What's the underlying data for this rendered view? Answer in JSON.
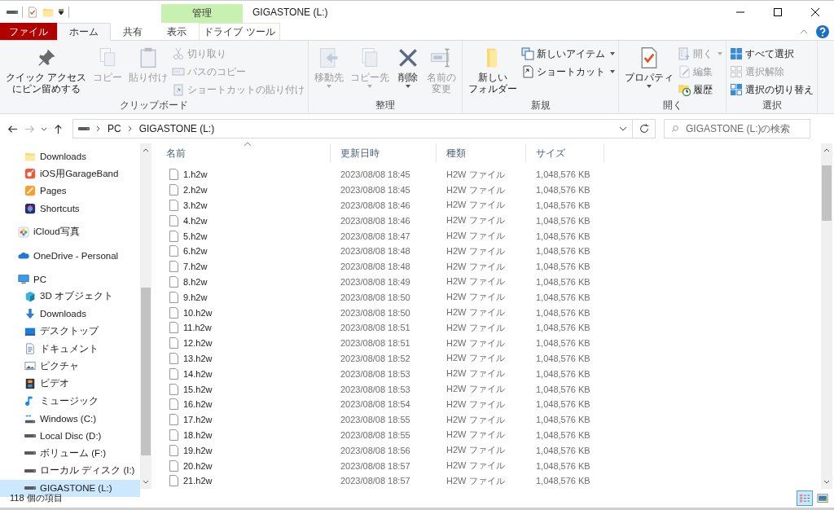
{
  "window": {
    "title": "GIGASTONE (L:)",
    "context_group": "管理"
  },
  "ribbon_tabs": [
    {
      "label": "ファイル",
      "kind": "file",
      "selected": false
    },
    {
      "label": "ホーム",
      "kind": "normal",
      "selected": true
    },
    {
      "label": "共有",
      "kind": "normal",
      "selected": false
    },
    {
      "label": "表示",
      "kind": "normal",
      "selected": false
    },
    {
      "label": "ドライブ ツール",
      "kind": "context",
      "selected": false
    }
  ],
  "ribbon_groups": [
    {
      "label": "クリップボード",
      "items": [
        {
          "lines": [
            "クイック アクセス",
            "にピン留めする"
          ],
          "kind": "large",
          "disabled": false,
          "has_menu": false
        },
        {
          "label": "コピー",
          "kind": "large",
          "disabled": true,
          "has_menu": false
        },
        {
          "label": "貼り付け",
          "kind": "large",
          "disabled": true,
          "has_menu": false
        },
        {
          "label": "切り取り",
          "kind": "small",
          "disabled": true,
          "has_menu": false
        },
        {
          "label": "パスのコピー",
          "kind": "small",
          "disabled": true,
          "has_menu": false
        },
        {
          "label": "ショートカットの貼り付け",
          "kind": "small",
          "disabled": true,
          "has_menu": false
        }
      ]
    },
    {
      "label": "整理",
      "items": [
        {
          "label": "移動先",
          "kind": "large",
          "disabled": true,
          "has_menu": true
        },
        {
          "label": "コピー先",
          "kind": "large",
          "disabled": true,
          "has_menu": true
        },
        {
          "label": "削除",
          "kind": "large",
          "disabled": false,
          "has_menu": true
        },
        {
          "lines": [
            "名前の",
            "変更"
          ],
          "kind": "large",
          "disabled": true,
          "has_menu": false
        }
      ]
    },
    {
      "label": "新規",
      "items": [
        {
          "lines": [
            "新しい",
            "フォルダー"
          ],
          "kind": "large",
          "disabled": false,
          "has_menu": false
        },
        {
          "label": "新しいアイテム",
          "kind": "small",
          "disabled": false,
          "has_menu": true
        },
        {
          "label": "ショートカット",
          "kind": "small",
          "disabled": false,
          "has_menu": true
        }
      ]
    },
    {
      "label": "開く",
      "items": [
        {
          "label": "プロパティ",
          "kind": "large",
          "disabled": false,
          "has_menu": true
        },
        {
          "label": "開く",
          "kind": "small",
          "disabled": true,
          "has_menu": true
        },
        {
          "label": "編集",
          "kind": "small",
          "disabled": true,
          "has_menu": false
        },
        {
          "label": "履歴",
          "kind": "small",
          "disabled": false,
          "has_menu": false
        }
      ]
    },
    {
      "label": "選択",
      "items": [
        {
          "label": "すべて選択",
          "kind": "small",
          "disabled": false,
          "has_menu": false
        },
        {
          "label": "選択解除",
          "kind": "small",
          "disabled": true,
          "has_menu": false
        },
        {
          "label": "選択の切り替え",
          "kind": "small",
          "disabled": false,
          "has_menu": false
        }
      ]
    }
  ],
  "address_bar": {
    "path": [
      "PC",
      "GIGASTONE (L:)"
    ]
  },
  "search": {
    "placeholder": "GIGASTONE (L:)の検索"
  },
  "sidebar": {
    "quick_access_children": [
      {
        "label": "Downloads",
        "kind": "folder",
        "selected": false
      },
      {
        "label": "iOS用GarageBand",
        "kind": "guitar-app",
        "selected": false
      },
      {
        "label": "Pages",
        "kind": "pen-app",
        "selected": false
      },
      {
        "label": "Shortcuts",
        "kind": "layers-app",
        "selected": false
      }
    ],
    "items": [
      {
        "label": "iCloud写真",
        "kind": "photos",
        "selected": false
      },
      {
        "label": "OneDrive - Personal",
        "kind": "cloud",
        "selected": false
      },
      {
        "label": "PC",
        "kind": "pc",
        "selected": false,
        "children": [
          {
            "label": "3D オブジェクト",
            "kind": "cube",
            "selected": false
          },
          {
            "label": "Downloads",
            "kind": "download",
            "selected": false
          },
          {
            "label": "デスクトップ",
            "kind": "desktop",
            "selected": false
          },
          {
            "label": "ドキュメント",
            "kind": "document",
            "selected": false
          },
          {
            "label": "ピクチャ",
            "kind": "picture",
            "selected": false
          },
          {
            "label": "ビデオ",
            "kind": "video",
            "selected": false
          },
          {
            "label": "ミュージック",
            "kind": "music",
            "selected": false
          },
          {
            "label": "Windows (C:)",
            "kind": "windows-drive",
            "selected": false
          },
          {
            "label": "Local Disc (D:)",
            "kind": "drive",
            "selected": false
          },
          {
            "label": "ボリューム (F:)",
            "kind": "drive",
            "selected": false
          },
          {
            "label": "ローカル ディスク (I:)",
            "kind": "drive",
            "selected": false
          },
          {
            "label": "GIGASTONE (L:)",
            "kind": "drive",
            "selected": true
          }
        ]
      }
    ]
  },
  "table": {
    "columns": [
      {
        "label": "名前",
        "sorted": true
      },
      {
        "label": "更新日時",
        "sorted": false
      },
      {
        "label": "種類",
        "sorted": false
      },
      {
        "label": "サイズ",
        "sorted": false
      }
    ],
    "rows": [
      {
        "name": "1.h2w",
        "modified": "2023/08/08 18:45",
        "type": "H2W ファイル",
        "size": "1,048,576 KB"
      },
      {
        "name": "2.h2w",
        "modified": "2023/08/08 18:45",
        "type": "H2W ファイル",
        "size": "1,048,576 KB"
      },
      {
        "name": "3.h2w",
        "modified": "2023/08/08 18:46",
        "type": "H2W ファイル",
        "size": "1,048,576 KB"
      },
      {
        "name": "4.h2w",
        "modified": "2023/08/08 18:46",
        "type": "H2W ファイル",
        "size": "1,048,576 KB"
      },
      {
        "name": "5.h2w",
        "modified": "2023/08/08 18:47",
        "type": "H2W ファイル",
        "size": "1,048,576 KB"
      },
      {
        "name": "6.h2w",
        "modified": "2023/08/08 18:48",
        "type": "H2W ファイル",
        "size": "1,048,576 KB"
      },
      {
        "name": "7.h2w",
        "modified": "2023/08/08 18:48",
        "type": "H2W ファイル",
        "size": "1,048,576 KB"
      },
      {
        "name": "8.h2w",
        "modified": "2023/08/08 18:49",
        "type": "H2W ファイル",
        "size": "1,048,576 KB"
      },
      {
        "name": "9.h2w",
        "modified": "2023/08/08 18:50",
        "type": "H2W ファイル",
        "size": "1,048,576 KB"
      },
      {
        "name": "10.h2w",
        "modified": "2023/08/08 18:50",
        "type": "H2W ファイル",
        "size": "1,048,576 KB"
      },
      {
        "name": "11.h2w",
        "modified": "2023/08/08 18:51",
        "type": "H2W ファイル",
        "size": "1,048,576 KB"
      },
      {
        "name": "12.h2w",
        "modified": "2023/08/08 18:51",
        "type": "H2W ファイル",
        "size": "1,048,576 KB"
      },
      {
        "name": "13.h2w",
        "modified": "2023/08/08 18:52",
        "type": "H2W ファイル",
        "size": "1,048,576 KB"
      },
      {
        "name": "14.h2w",
        "modified": "2023/08/08 18:53",
        "type": "H2W ファイル",
        "size": "1,048,576 KB"
      },
      {
        "name": "15.h2w",
        "modified": "2023/08/08 18:53",
        "type": "H2W ファイル",
        "size": "1,048,576 KB"
      },
      {
        "name": "16.h2w",
        "modified": "2023/08/08 18:54",
        "type": "H2W ファイル",
        "size": "1,048,576 KB"
      },
      {
        "name": "17.h2w",
        "modified": "2023/08/08 18:55",
        "type": "H2W ファイル",
        "size": "1,048,576 KB"
      },
      {
        "name": "18.h2w",
        "modified": "2023/08/08 18:55",
        "type": "H2W ファイル",
        "size": "1,048,576 KB"
      },
      {
        "name": "19.h2w",
        "modified": "2023/08/08 18:56",
        "type": "H2W ファイル",
        "size": "1,048,576 KB"
      },
      {
        "name": "20.h2w",
        "modified": "2023/08/08 18:57",
        "type": "H2W ファイル",
        "size": "1,048,576 KB"
      },
      {
        "name": "21.h2w",
        "modified": "2023/08/08 18:57",
        "type": "H2W ファイル",
        "size": "1,048,576 KB"
      }
    ]
  },
  "status_bar": {
    "item_count": "118 個の項目"
  },
  "view_buttons": [
    {
      "kind": "details",
      "selected": true
    },
    {
      "kind": "large-icons",
      "selected": false
    }
  ]
}
